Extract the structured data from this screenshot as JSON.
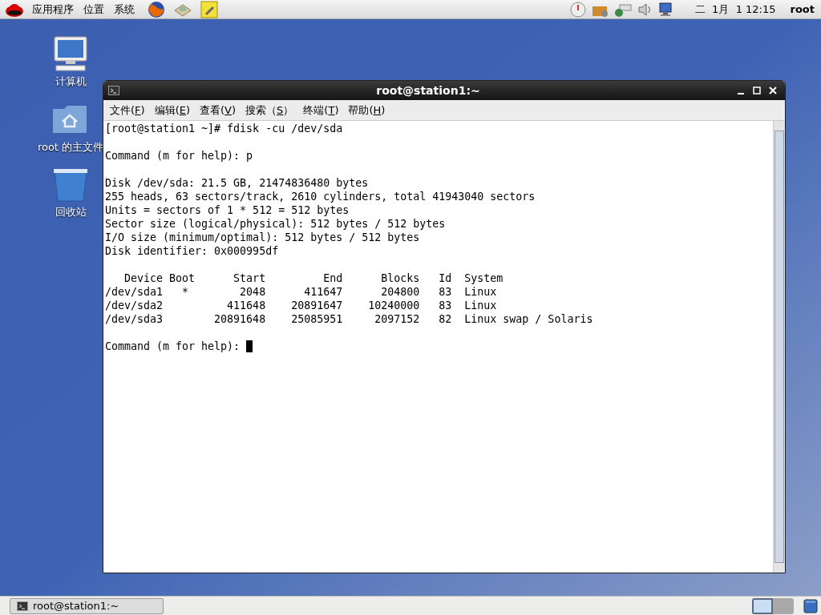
{
  "top_panel": {
    "menus": [
      "应用程序",
      "位置",
      "系统"
    ],
    "clock": "二  1月  1 12:15",
    "user": "root"
  },
  "desktop_icons": [
    {
      "kind": "computer",
      "label": "计算机"
    },
    {
      "kind": "home",
      "label": "root 的主文件"
    },
    {
      "kind": "trash",
      "label": "回收站"
    }
  ],
  "window": {
    "title": "root@station1:~",
    "menu": [
      {
        "before": "文件(",
        "key": "F",
        "after": ")"
      },
      {
        "before": "编辑(",
        "key": "E",
        "after": ")"
      },
      {
        "before": "查看(",
        "key": "V",
        "after": ")"
      },
      {
        "before": "搜索（",
        "key": "S",
        "after": "）"
      },
      {
        "before": "终端(",
        "key": "T",
        "after": ")"
      },
      {
        "before": "帮助(",
        "key": "H",
        "after": ")"
      }
    ],
    "terminal_blocks": [
      [
        "[root@station1 ~]# fdisk -cu /dev/sda"
      ],
      [
        "Command (m for help): p"
      ],
      [
        "Disk /dev/sda: 21.5 GB, 21474836480 bytes",
        "255 heads, 63 sectors/track, 2610 cylinders, total 41943040 sectors",
        "Units = sectors of 1 * 512 = 512 bytes",
        "Sector size (logical/physical): 512 bytes / 512 bytes",
        "I/O size (minimum/optimal): 512 bytes / 512 bytes",
        "Disk identifier: 0x000995df"
      ],
      [
        "   Device Boot      Start         End      Blocks   Id  System",
        "/dev/sda1   *        2048      411647      204800   83  Linux",
        "/dev/sda2          411648    20891647    10240000   83  Linux",
        "/dev/sda3        20891648    25085951     2097152   82  Linux swap / Solaris"
      ],
      [
        "Command (m for help): "
      ]
    ]
  },
  "taskbar": {
    "tasks": [
      {
        "label": "root@station1:~",
        "selected": false
      }
    ],
    "workspaces": [
      {
        "selected": true
      },
      {
        "selected": false
      }
    ]
  }
}
